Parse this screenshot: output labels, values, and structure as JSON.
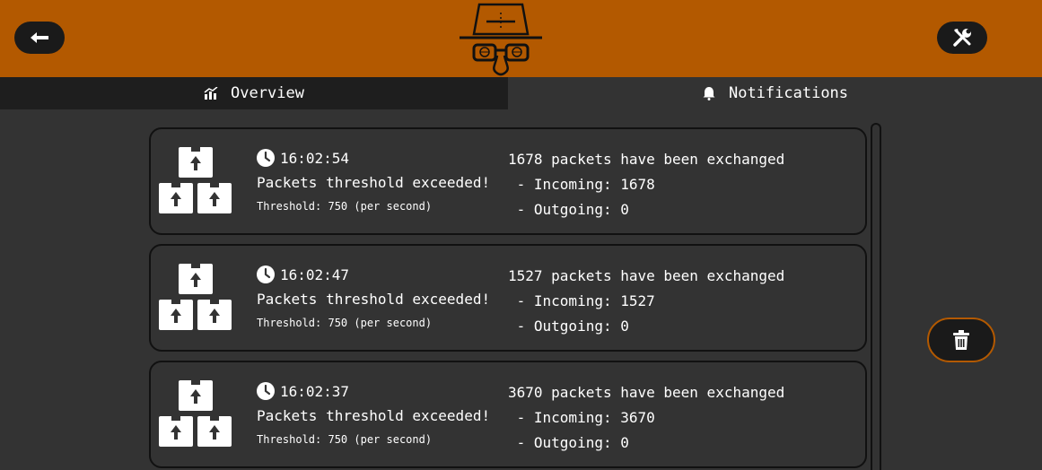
{
  "header": {
    "back_icon": "arrow-left-icon",
    "settings_icon": "tools-icon",
    "logo": "spy-hat-glasses-logo",
    "brand_color": "#b35900"
  },
  "tabs": [
    {
      "label": "Overview",
      "icon": "chart-icon",
      "active": false
    },
    {
      "label": "Notifications",
      "icon": "bell-icon",
      "active": true
    }
  ],
  "notifications": [
    {
      "time": "16:02:54",
      "title": "Packets threshold exceeded!",
      "threshold": "Threshold: 750 (per second)",
      "summary": "1678 packets have been exchanged",
      "incoming": " - Incoming: 1678",
      "outgoing": " - Outgoing: 0"
    },
    {
      "time": "16:02:47",
      "title": "Packets threshold exceeded!",
      "threshold": "Threshold: 750 (per second)",
      "summary": "1527 packets have been exchanged",
      "incoming": " - Incoming: 1527",
      "outgoing": " - Outgoing: 0"
    },
    {
      "time": "16:02:37",
      "title": "Packets threshold exceeded!",
      "threshold": "Threshold: 750 (per second)",
      "summary": "3670 packets have been exchanged",
      "incoming": " - Incoming: 3670",
      "outgoing": " - Outgoing: 0"
    }
  ],
  "actions": {
    "delete_icon": "trash-icon"
  }
}
